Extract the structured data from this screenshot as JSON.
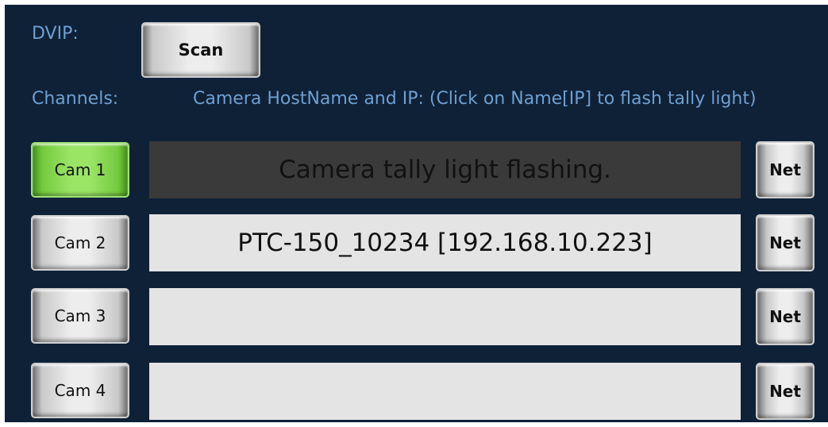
{
  "header": {
    "dvip_label": "DVIP:",
    "scan_label": "Scan",
    "channels_label": "Channels:",
    "hostname_label": "Camera HostName and IP: (Click on Name[IP] to flash tally light)"
  },
  "channels": [
    {
      "cam_label": "Cam 1",
      "host_text": "Camera tally light flashing.",
      "net_label": "Net",
      "active": true
    },
    {
      "cam_label": "Cam 2",
      "host_text": "PTC-150_10234 [192.168.10.223]",
      "net_label": "Net",
      "active": false
    },
    {
      "cam_label": "Cam 3",
      "host_text": "",
      "net_label": "Net",
      "active": false
    },
    {
      "cam_label": "Cam 4",
      "host_text": "",
      "net_label": "Net",
      "active": false
    }
  ],
  "colors": {
    "panel_bg": "#0e2137",
    "label_text": "#6f9fd0",
    "active_green": "#9be566",
    "flashing_field": "#3a3a3a",
    "field_bg": "#e4e4e4"
  }
}
